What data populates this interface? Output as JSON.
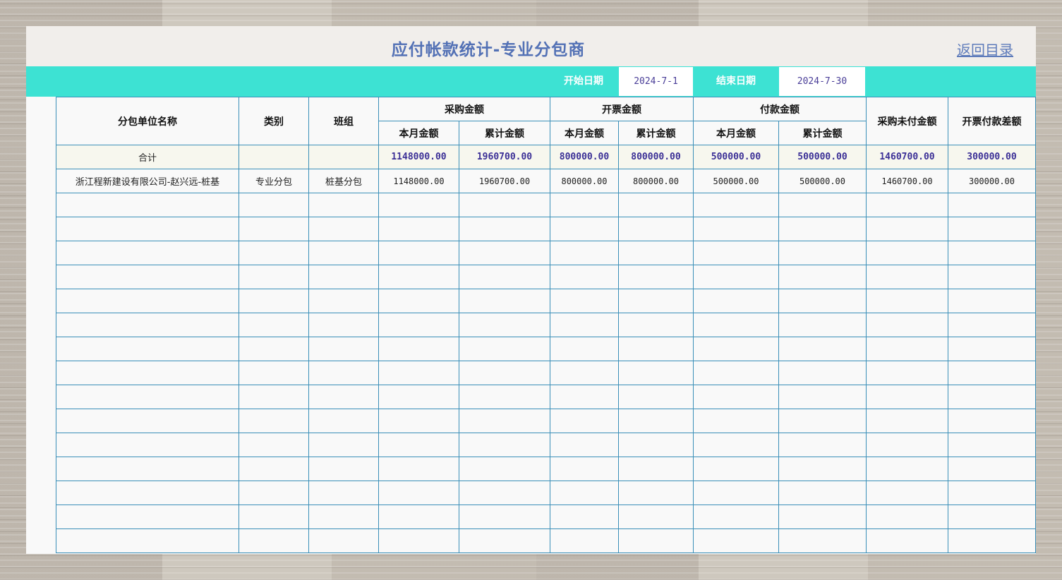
{
  "title": "应付帐款统计-专业分包商",
  "back_link": "返回目录",
  "date_range": {
    "start_label": "开始日期",
    "start_value": "2024-7-1",
    "end_label": "结束日期",
    "end_value": "2024-7-30"
  },
  "table": {
    "headers": {
      "name": "分包单位名称",
      "category": "类别",
      "team": "班组",
      "purchase_amount": "采购金额",
      "invoice_amount": "开票金额",
      "payment_amount": "付款金额",
      "this_month": "本月金额",
      "cumulative": "累计金额",
      "unpaid_purchase": "采购未付金额",
      "invoice_payment_diff": "开票付款差额"
    },
    "total_row": {
      "label": "合计",
      "values": [
        "1148000.00",
        "1960700.00",
        "800000.00",
        "800000.00",
        "500000.00",
        "500000.00",
        "1460700.00",
        "300000.00"
      ]
    },
    "rows": [
      {
        "name": "浙江程新建设有限公司-赵兴远-桩基",
        "category": "专业分包",
        "team": "桩基分包",
        "values": [
          "1148000.00",
          "1960700.00",
          "800000.00",
          "800000.00",
          "500000.00",
          "500000.00",
          "1460700.00",
          "300000.00"
        ]
      }
    ]
  }
}
